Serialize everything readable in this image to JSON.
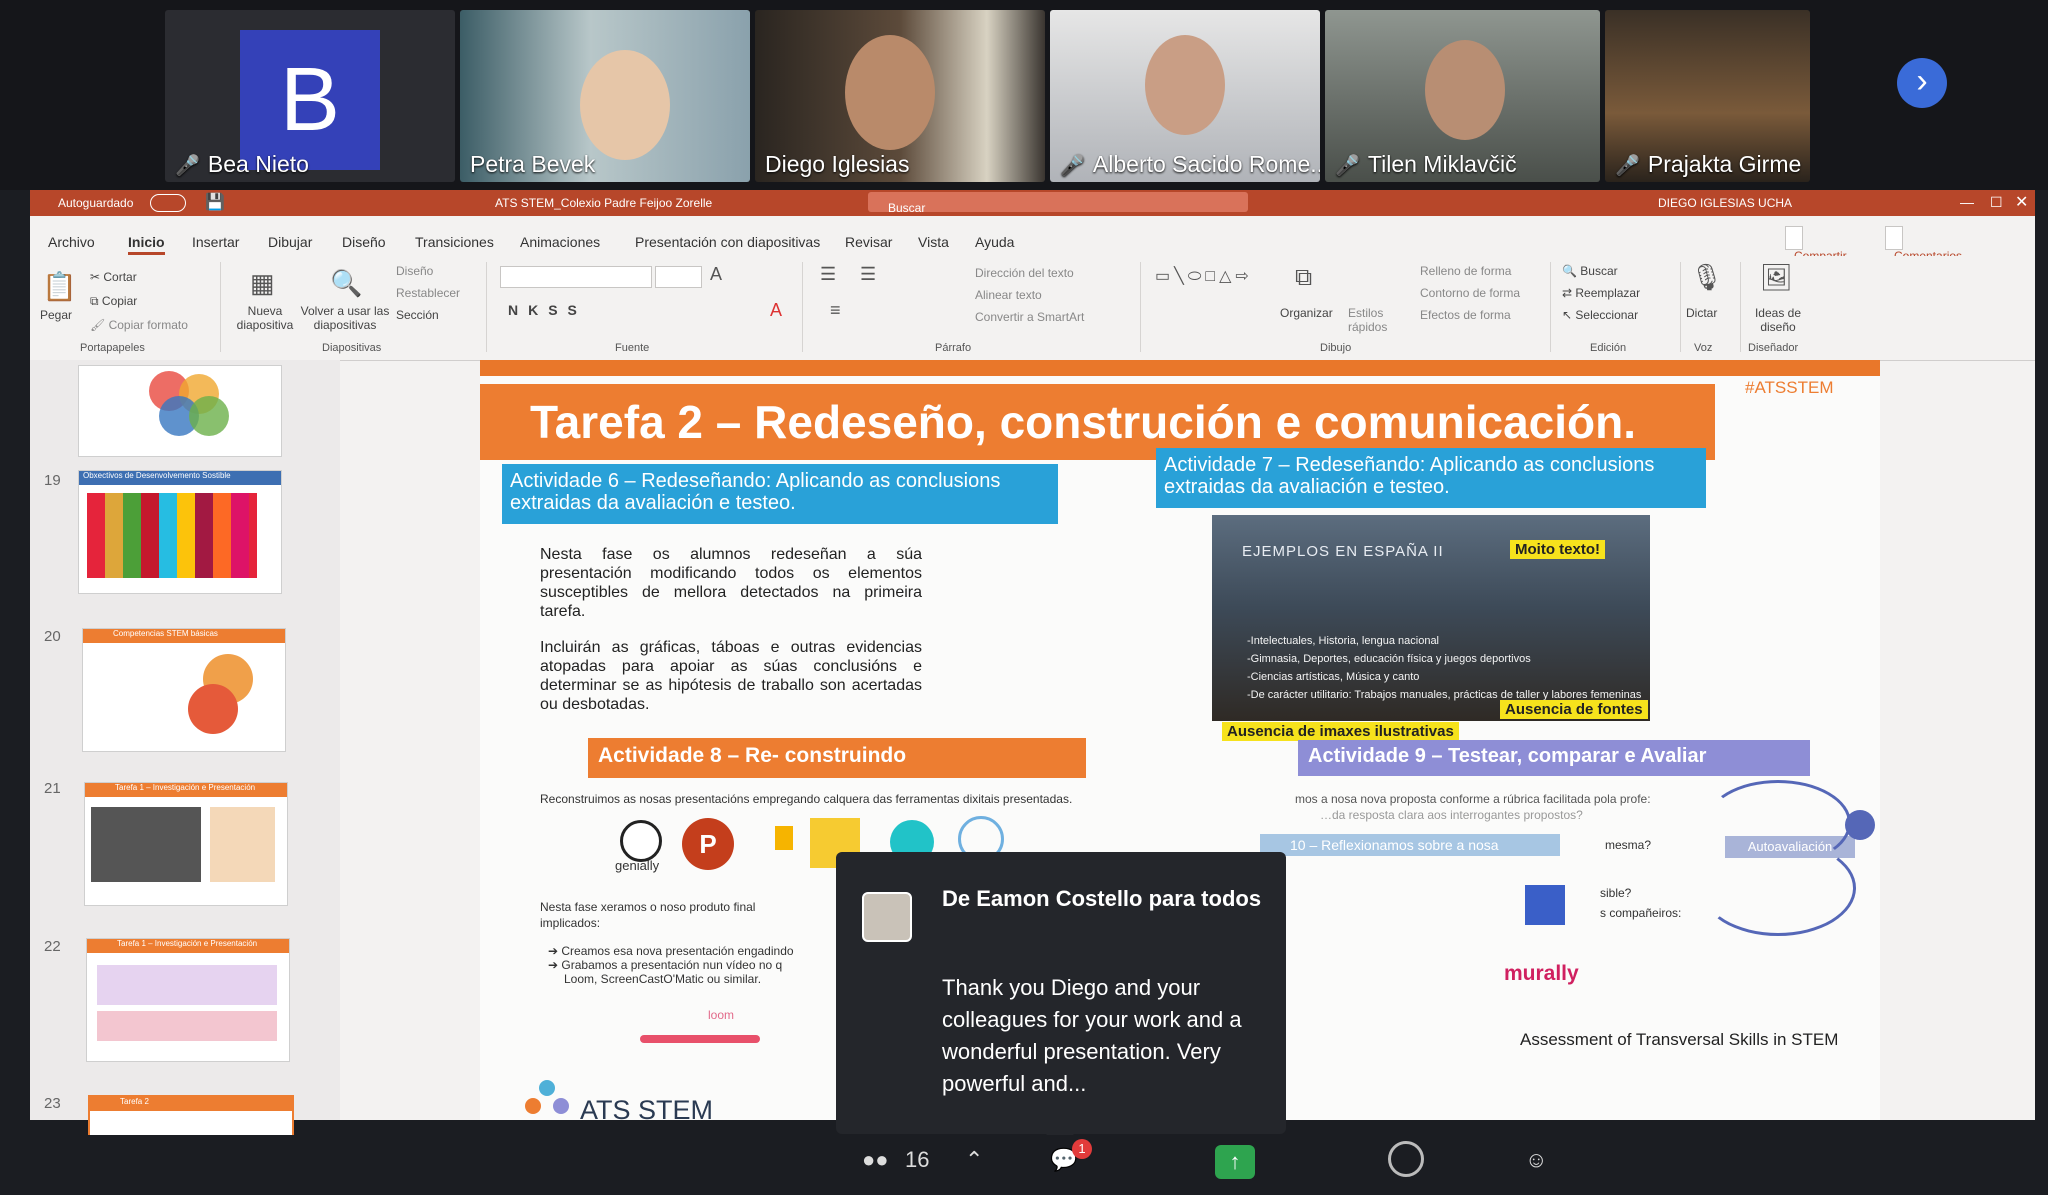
{
  "meeting": {
    "participants": [
      {
        "name": "Bea Nieto",
        "initial": "B",
        "muted": true
      },
      {
        "name": "Petra Bevek",
        "muted": false
      },
      {
        "name": "Diego Iglesias",
        "muted": false
      },
      {
        "name": "Alberto Sacido Rome...",
        "muted": true
      },
      {
        "name": "Tilen Miklavčič",
        "muted": true
      },
      {
        "name": "Prajakta Girme",
        "muted": true
      }
    ],
    "participant_count": "16",
    "chat_badge": "1"
  },
  "powerpoint": {
    "autosave_label": "Autoguardado",
    "file_title": "ATS STEM_Colexio Padre Feijoo Zorelle",
    "search_placeholder": "Buscar",
    "user": "DIEGO IGLESIAS UCHA",
    "tabs": [
      "Archivo",
      "Inicio",
      "Insertar",
      "Dibujar",
      "Diseño",
      "Transiciones",
      "Animaciones",
      "Presentación con diapositivas",
      "Revisar",
      "Vista",
      "Ayuda"
    ],
    "share_label": "Compartir",
    "comments_label": "Comentarios",
    "ribbon": {
      "paste": "Pegar",
      "cut": "Cortar",
      "copy": "Copiar",
      "copy_format": "Copiar formato",
      "clipboard_group": "Portapapeles",
      "new_slide": "Nueva diapositiva",
      "reuse_slides": "Volver a usar las diapositivas",
      "layout": "Diseño",
      "reset": "Restablecer",
      "section": "Sección",
      "slides_group": "Diapositivas",
      "font_group": "Fuente",
      "paragraph_group": "Párrafo",
      "text_direction": "Dirección del texto",
      "align_text": "Alinear texto",
      "smartart": "Convertir a SmartArt",
      "arrange": "Organizar",
      "quick_styles": "Estilos rápidos",
      "shape_fill": "Relleno de forma",
      "shape_outline": "Contorno de forma",
      "shape_effects": "Efectos de forma",
      "drawing_group": "Dibujo",
      "find": "Buscar",
      "replace": "Reemplazar",
      "select": "Seleccionar",
      "editing_group": "Edición",
      "dictate": "Dictar",
      "voice_group": "Voz",
      "design_ideas": "Ideas de diseño",
      "designer_group": "Diseñador"
    },
    "thumbnails": [
      {
        "num": "19",
        "title": "Obxectivos de Desenvolvemento Sostible"
      },
      {
        "num": "20",
        "title": "Competencias STEM básicas"
      },
      {
        "num": "21",
        "title": "Tarefa 1 – Investigación e Presentación"
      },
      {
        "num": "22",
        "title": "Tarefa 1 – Investigación e Presentación"
      },
      {
        "num": "23",
        "title": "Tarefa 2"
      }
    ]
  },
  "slide": {
    "title": "Tarefa 2 – Redeseño, construción e comunicación.",
    "hashtag": "#ATSSTEM",
    "act6_title": "Actividade 6 – Redeseñando: Aplicando as conclusions extraidas da avaliación e testeo.",
    "act7_title": "Actividade 7 – Redeseñando: Aplicando as conclusions extraidas da avaliación e testeo.",
    "para1": "Nesta fase os alumnos redeseñan a súa presentación modificando todos os elementos susceptibles de mellora detectados na primeira tarefa.",
    "para2": "Incluirán as gráficas, táboas e outras evidencias atopadas para apoiar as súas conclusións e determinar se as hipótesis de traballo son acertadas ou desbotadas.",
    "examples_title": "EJEMPLOS EN ESPAÑA II",
    "examples_lines": [
      "-Intelectuales, Historia, lengua nacional",
      "-Gimnasia, Deportes, educación física y juegos deportivos",
      "-Ciencias artísticas, Música y canto",
      "-De carácter utilitario: Trabajos manuales, prácticas de taller y labores femeninas"
    ],
    "tag_moito_texto": "Moito texto!",
    "tag_fontes": "Ausencia de fontes",
    "tag_imaxes": "Ausencia de imaxes ilustrativas",
    "act8_title": "Actividade 8 – Re- construindo",
    "act8_text": "Reconstruimos as nosas presentacións empregando calquera das ferramentas dixitais presentadas.",
    "genially": "genially",
    "act9_title": "Actividade 9 – Testear, comparar e Avaliar",
    "act9_text": "mos a nosa nova proposta conforme a rúbrica facilitada pola profe:",
    "act9_sub": "…da resposta clara aos interrogantes propostos?",
    "reflexion": "10 – Reflexionamos sobre a nosa",
    "autoavaliacion": "Autoavaliación",
    "mesma": "mesma?",
    "sible": "sible?",
    "companeiros": "s compañeiros:",
    "final_text": "Nesta fase xeramos o noso produto final",
    "implicados": "implicados:",
    "bullet1": "Creamos esa nova presentación engadindo",
    "bullet2": "Grabamos a presentación nun vídeo no q",
    "bullet3": "Loom, ScreenCastO'Matic ou similar.",
    "loom": "loom",
    "murally": "murally",
    "brand": "ATS STEM",
    "footer": "Assessment of Transversal Skills in STEM"
  },
  "chat": {
    "from": "De Eamon Costello para todos",
    "message": "Thank you Diego and your colleagues for your work and a wonderful presentation. Very powerful and..."
  },
  "colors": {
    "accent_orange": "#ed7d31",
    "accent_blue": "#29a1d8",
    "ppt_red": "#b7472a",
    "zoom_blue": "#3a6bd8"
  }
}
